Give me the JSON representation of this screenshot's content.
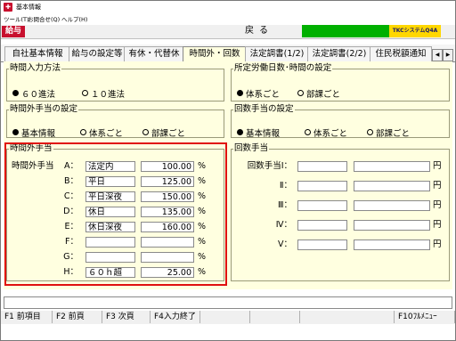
{
  "window": {
    "title": "基本情報",
    "app_badge": "給与",
    "back_button": "戻る",
    "brand_logo_text": "TKCシステムQ4A"
  },
  "menu": [
    "ツール(T)",
    "お問合せ(Q)",
    "ヘルプ(H)"
  ],
  "tabs": [
    "自社基本情報",
    "給与の設定等",
    "有休・代替休",
    "時間外・回数",
    "法定調書(1/2)",
    "法定調書(2/2)",
    "住民税額通知"
  ],
  "active_tab": "時間外・回数",
  "time_input": {
    "legend": "時間入力方法",
    "options": [
      "６０進法",
      "１０進法"
    ],
    "selected": "６０進法"
  },
  "scheduled_work": {
    "legend": "所定労働日数･時間の設定",
    "options": [
      "体系ごと",
      "部課ごと"
    ],
    "selected": "体系ごと"
  },
  "overtime_setting": {
    "legend": "時間外手当の設定",
    "options": [
      "基本情報",
      "体系ごと",
      "部課ごと"
    ],
    "selected": "基本情報"
  },
  "count_setting": {
    "legend": "回数手当の設定",
    "options": [
      "基本情報",
      "体系ごと",
      "部課ごと"
    ],
    "selected": "基本情報"
  },
  "overtime_allowance": {
    "legend": "時間外手当",
    "prefix": "時間外手当",
    "unit": "%",
    "rows": [
      {
        "label": "A：",
        "name": "法定内",
        "rate": "100.00"
      },
      {
        "label": "B：",
        "name": "平日",
        "rate": "125.00"
      },
      {
        "label": "C：",
        "name": "平日深夜",
        "rate": "150.00"
      },
      {
        "label": "D：",
        "name": "休日",
        "rate": "135.00"
      },
      {
        "label": "E：",
        "name": "休日深夜",
        "rate": "160.00"
      },
      {
        "label": "F：",
        "name": "",
        "rate": ""
      },
      {
        "label": "G：",
        "name": "",
        "rate": ""
      },
      {
        "label": "H：",
        "name": "６０ｈ超",
        "rate": "25.00"
      }
    ]
  },
  "count_allowance": {
    "legend": "回数手当",
    "unit": "円",
    "rows": [
      {
        "label": "回数手当Ⅰ："
      },
      {
        "label": "Ⅱ："
      },
      {
        "label": "Ⅲ："
      },
      {
        "label": "Ⅳ："
      },
      {
        "label": "Ⅴ："
      }
    ]
  },
  "function_keys": [
    "F1 前項目",
    "F2 前頁",
    "F3 次頁",
    "F4入力終了",
    "",
    "",
    "",
    "F10ﾌﾙﾒﾆｭｰ"
  ],
  "colors": {
    "brand_red": "#c8102e",
    "panel_bg": "#ffffe0",
    "highlight_border": "#e01010",
    "green_bar": "#00b000",
    "logo_yellow": "#ffd700"
  }
}
